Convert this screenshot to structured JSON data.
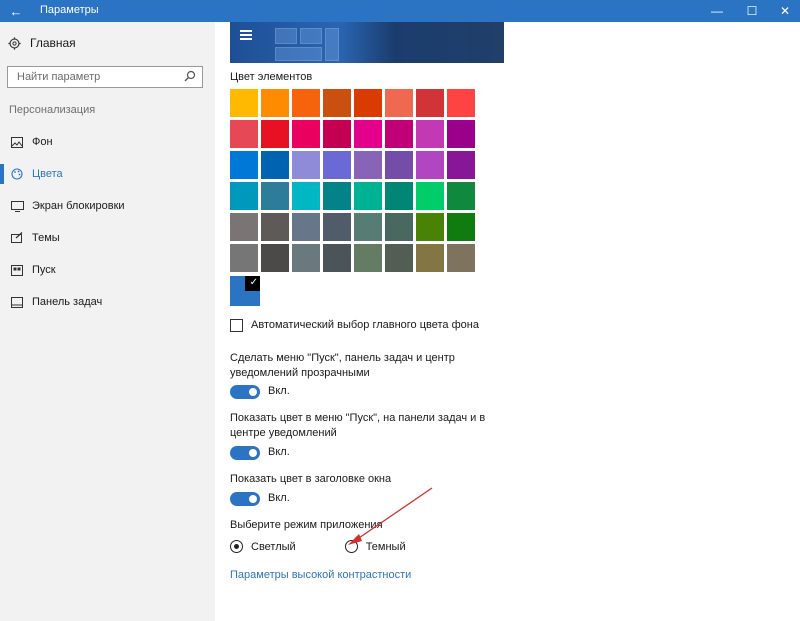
{
  "window": {
    "title": "Параметры",
    "back_glyph": "←",
    "min_glyph": "—",
    "max_glyph": "☐",
    "close_glyph": "✕"
  },
  "sidebar": {
    "home_label": "Главная",
    "search_placeholder": "Найти параметр",
    "section_label": "Персонализация",
    "items": [
      {
        "label": "Фон",
        "icon": "picture-icon"
      },
      {
        "label": "Цвета",
        "icon": "palette-icon",
        "active": true
      },
      {
        "label": "Экран блокировки",
        "icon": "lock-screen-icon"
      },
      {
        "label": "Темы",
        "icon": "themes-icon"
      },
      {
        "label": "Пуск",
        "icon": "start-icon"
      },
      {
        "label": "Панель задач",
        "icon": "taskbar-icon"
      }
    ]
  },
  "main": {
    "accent_heading": "Цвет элементов",
    "swatches": [
      "#ffb900",
      "#ff8c00",
      "#f7630c",
      "#ca5010",
      "#da3b01",
      "#ef6950",
      "#d13438",
      "#ff4343",
      "#e74856",
      "#e81123",
      "#ea005e",
      "#c30052",
      "#e3008c",
      "#bf0077",
      "#c239b3",
      "#9a0089",
      "#0078d7",
      "#0063b1",
      "#8e8cd8",
      "#6b69d6",
      "#8764b8",
      "#744da9",
      "#b146c2",
      "#881798",
      "#0099bc",
      "#2d7d9a",
      "#00b7c3",
      "#038387",
      "#00b294",
      "#018574",
      "#00cc6a",
      "#10893e",
      "#7a7574",
      "#5d5a58",
      "#68768a",
      "#515c6b",
      "#567c73",
      "#486860",
      "#498205",
      "#107c10",
      "#767676",
      "#4c4a48",
      "#69797e",
      "#4a5459",
      "#647c64",
      "#525e54",
      "#847545",
      "#7e735f"
    ],
    "selected_color": "#2b74c4",
    "auto_color_label": "Автоматический выбор главного цвета фона",
    "transparency_label": "Сделать меню \"Пуск\", панель задач и центр уведомлений прозрачными",
    "transparency_state": "Вкл.",
    "show_color_start_label": "Показать цвет в меню \"Пуск\", на панели задач и в центре уведомлений",
    "show_color_start_state": "Вкл.",
    "show_color_title_label": "Показать цвет в заголовке окна",
    "show_color_title_state": "Вкл.",
    "app_mode_label": "Выберите режим приложения",
    "mode_light": "Светлый",
    "mode_dark": "Темный",
    "high_contrast_link": "Параметры высокой контрастности"
  },
  "colors": {
    "accent": "#2b74c4",
    "annotation_arrow": "#d32f2f"
  }
}
